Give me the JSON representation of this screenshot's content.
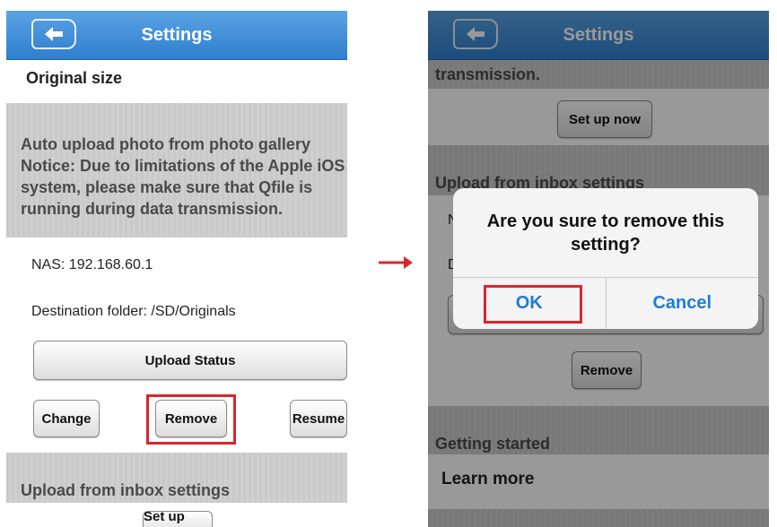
{
  "left": {
    "nav": {
      "title": "Settings"
    },
    "original_size": "Original size",
    "auto_upload": {
      "title": "Auto upload photo from photo gallery",
      "notice": "Notice: Due to limitations of the Apple iOS system, please make sure that Qfile is running during data transmission."
    },
    "nas_label": "NAS: 192.168.60.1",
    "dest_label": "Destination folder: /SD/Originals",
    "upload_status": "Upload Status",
    "change": "Change",
    "remove": "Remove",
    "resume": "Resume",
    "inbox_title": "Upload from inbox settings",
    "setup_now": "Set up now"
  },
  "right": {
    "nav": {
      "title": "Settings"
    },
    "transmission_tail": "transmission.",
    "setup_now": "Set up now",
    "inbox_title": "Upload from inbox settings",
    "remove": "Remove",
    "getting_started": "Getting started",
    "learn_more": "Learn more",
    "dialog": {
      "message": "Are you sure to remove this setting?",
      "ok": "OK",
      "cancel": "Cancel"
    }
  },
  "colors": {
    "nav": "#2f7fd0",
    "highlight": "#d9262b",
    "dialog_button": "#1f7bd6"
  }
}
